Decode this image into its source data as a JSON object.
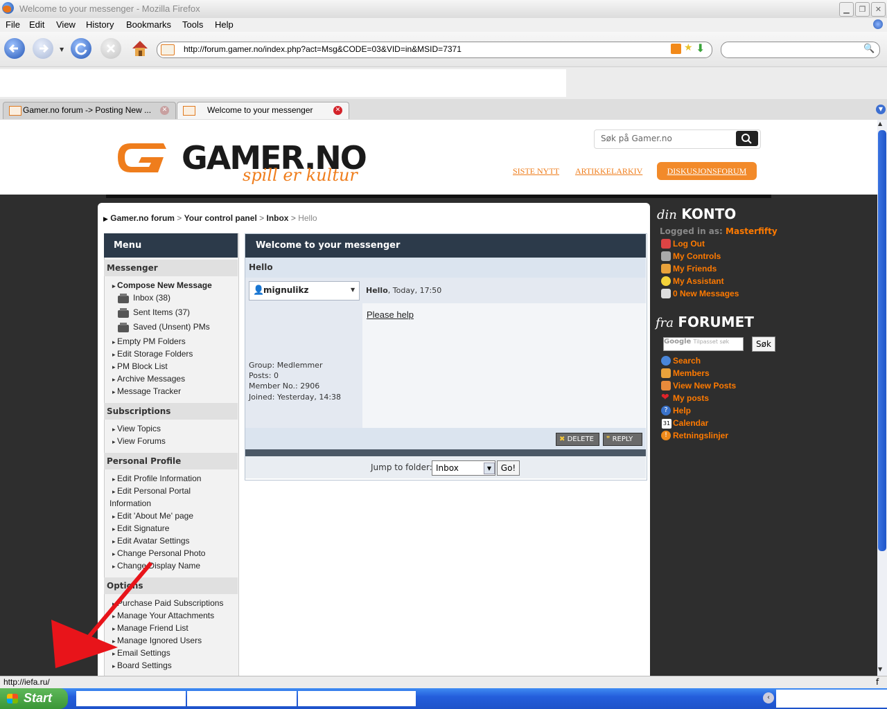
{
  "window": {
    "title": "Welcome to your messenger - Mozilla Firefox"
  },
  "menubar": [
    "File",
    "Edit",
    "View",
    "History",
    "Bookmarks",
    "Tools",
    "Help"
  ],
  "navbar": {
    "url": "http://forum.gamer.no/index.php?act=Msg&CODE=03&VID=in&MSID=7371"
  },
  "tabs": [
    {
      "label": "Gamer.no forum -> Posting New ..."
    },
    {
      "label": "Welcome to your messenger"
    }
  ],
  "site": {
    "logo_text": "GAMER.NO",
    "logo_tagline": "spill er kultur",
    "search_placeholder": "Søk på Gamer.no",
    "nav": [
      "SISTE NYTT",
      "ARTIKKELARKIV",
      "DISKUSJONSFORUM"
    ]
  },
  "breadcrumb": {
    "items": [
      "Gamer.no forum",
      "Your control panel",
      "Inbox"
    ],
    "sep": ">",
    "current": "Hello"
  },
  "menu": {
    "title": "Menu",
    "messenger": {
      "heading": "Messenger",
      "compose": "Compose New Message",
      "folders": [
        "Inbox (38)",
        "Sent Items (37)",
        "Saved (Unsent) PMs"
      ],
      "items": [
        "Empty PM Folders",
        "Edit Storage Folders",
        "PM Block List",
        "Archive Messages",
        "Message Tracker"
      ]
    },
    "subscriptions": {
      "heading": "Subscriptions",
      "items": [
        "View Topics",
        "View Forums"
      ]
    },
    "profile": {
      "heading": "Personal Profile",
      "items": [
        "Edit Profile Information",
        "Edit Personal Portal",
        "Information",
        "Edit 'About Me' page",
        "Edit Signature",
        "Edit Avatar Settings",
        "Change Personal Photo",
        "Change Display Name"
      ]
    },
    "options": {
      "heading": "Options",
      "items": [
        "Purchase Paid Subscriptions",
        "Manage Your Attachments",
        "Manage Friend List",
        "Manage Ignored Users",
        "Email Settings",
        "Board Settings"
      ]
    }
  },
  "message": {
    "panel_title": "Welcome to your messenger",
    "subject": "Hello",
    "author": "mignulikz",
    "post_title": "Hello",
    "post_date": ", Today, 17:50",
    "body": "Please help",
    "group": "Group: Medlemmer",
    "posts": "Posts: 0",
    "member_no": "Member No.: 2906",
    "joined": "Joined: Yesterday, 14:38",
    "delete_label": "DELETE",
    "reply_label": "REPLY",
    "jump_label": "Jump to folder:",
    "jump_value": "Inbox",
    "go_label": "Go!"
  },
  "account": {
    "heading_prefix": "din",
    "heading_main": "KONTO",
    "logged_in_label": "Logged in as:",
    "username": "Masterfifty",
    "links": [
      "Log Out",
      "My Controls",
      "My Friends",
      "My Assistant",
      "0 New Messages"
    ]
  },
  "forum_box": {
    "heading_prefix": "fra",
    "heading_main": "FORUMET",
    "search_placeholder": "Tilpasset søk",
    "google": "Google",
    "search_button": "Søk",
    "links": [
      "Search",
      "Members",
      "View New Posts",
      "My posts",
      "Help",
      "Calendar",
      "Retningslinjer"
    ]
  },
  "statusbar": {
    "text": "http://iefa.ru/",
    "right": "f"
  },
  "taskbar": {
    "start": "Start"
  },
  "colors": {
    "accent_orange": "#ff7a00",
    "panel_dark": "#2c3a4a",
    "panel_light": "#dbe4ef",
    "arrow_red": "#e8141a"
  }
}
